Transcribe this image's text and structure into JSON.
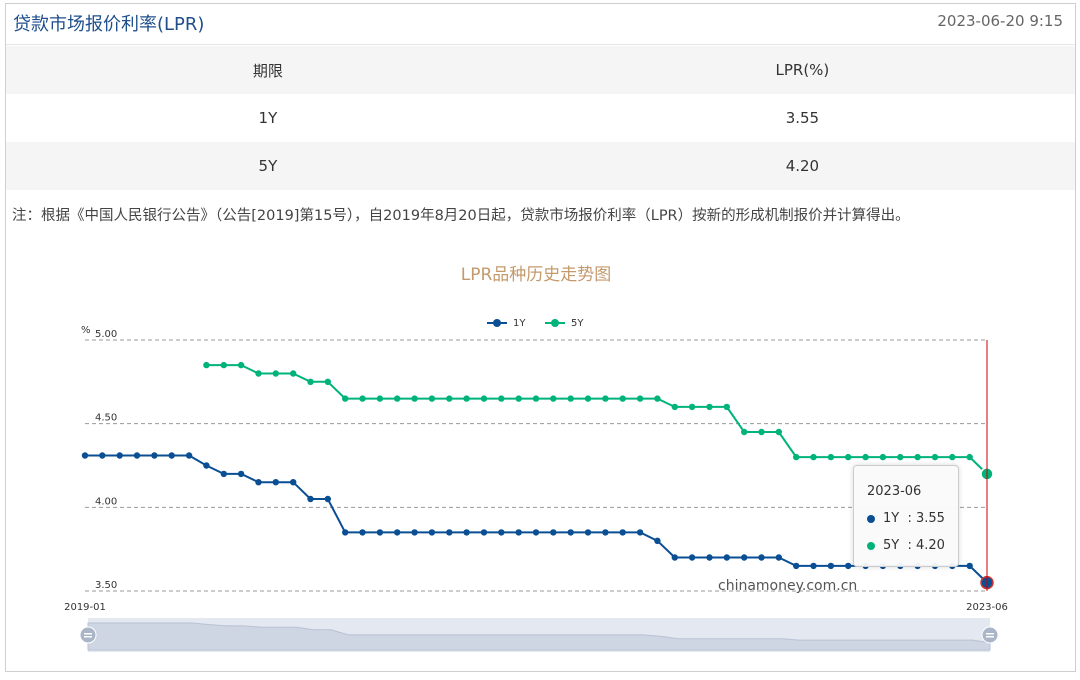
{
  "header": {
    "title": "贷款市场报价利率(LPR)",
    "timestamp": "2023-06-20 9:15"
  },
  "table": {
    "headers": [
      "期限",
      "LPR(%)"
    ],
    "rows": [
      {
        "term": "1Y",
        "rate": "3.55"
      },
      {
        "term": "5Y",
        "rate": "4.20"
      }
    ]
  },
  "note": "注：根据《中国人民银行公告》（公告[2019]第15号），自2019年8月20日起，贷款市场报价利率（LPR）按新的形成机制报价并计算得出。",
  "tooltip": {
    "date": "2023-06",
    "items": [
      {
        "name": "1Y",
        "value": ": 3.55"
      },
      {
        "name": "5Y",
        "value": ": 4.20"
      }
    ]
  },
  "watermark": "chinamoney.com.cn",
  "colors": {
    "series_1y": "#0a4e93",
    "series_5y": "#00b37a",
    "title": "#c49a6c",
    "marker_line": "#cc0000",
    "header_text": "#1e4f8c"
  },
  "chart_data": {
    "type": "line",
    "title": "LPR品种历史走势图",
    "ylabel": "%",
    "ylim": [
      3.5,
      5.0
    ],
    "yticks": [
      "5.00",
      "4.50",
      "4.00",
      "3.50"
    ],
    "x_range": [
      "2019-01",
      "2023-06"
    ],
    "xtick_labels": [
      "2019-01",
      "2023-06"
    ],
    "legend": "top-center",
    "grid": "horizontal-dashed",
    "series": [
      {
        "name": "1Y",
        "values": [
          4.31,
          4.31,
          4.31,
          4.31,
          4.31,
          4.31,
          4.31,
          4.25,
          4.2,
          4.2,
          4.15,
          4.15,
          4.15,
          4.05,
          4.05,
          3.85,
          3.85,
          3.85,
          3.85,
          3.85,
          3.85,
          3.85,
          3.85,
          3.85,
          3.85,
          3.85,
          3.85,
          3.85,
          3.85,
          3.85,
          3.85,
          3.85,
          3.85,
          3.8,
          3.7,
          3.7,
          3.7,
          3.7,
          3.7,
          3.7,
          3.7,
          3.65,
          3.65,
          3.65,
          3.65,
          3.65,
          3.65,
          3.65,
          3.65,
          3.65,
          3.65,
          3.65,
          3.55
        ]
      },
      {
        "name": "5Y",
        "values": [
          null,
          null,
          null,
          null,
          null,
          null,
          null,
          4.85,
          4.85,
          4.85,
          4.8,
          4.8,
          4.8,
          4.75,
          4.75,
          4.65,
          4.65,
          4.65,
          4.65,
          4.65,
          4.65,
          4.65,
          4.65,
          4.65,
          4.65,
          4.65,
          4.65,
          4.65,
          4.65,
          4.65,
          4.65,
          4.65,
          4.65,
          4.65,
          4.6,
          4.6,
          4.6,
          4.6,
          4.45,
          4.45,
          4.45,
          4.3,
          4.3,
          4.3,
          4.3,
          4.3,
          4.3,
          4.3,
          4.3,
          4.3,
          4.3,
          4.3,
          4.2
        ]
      }
    ]
  }
}
